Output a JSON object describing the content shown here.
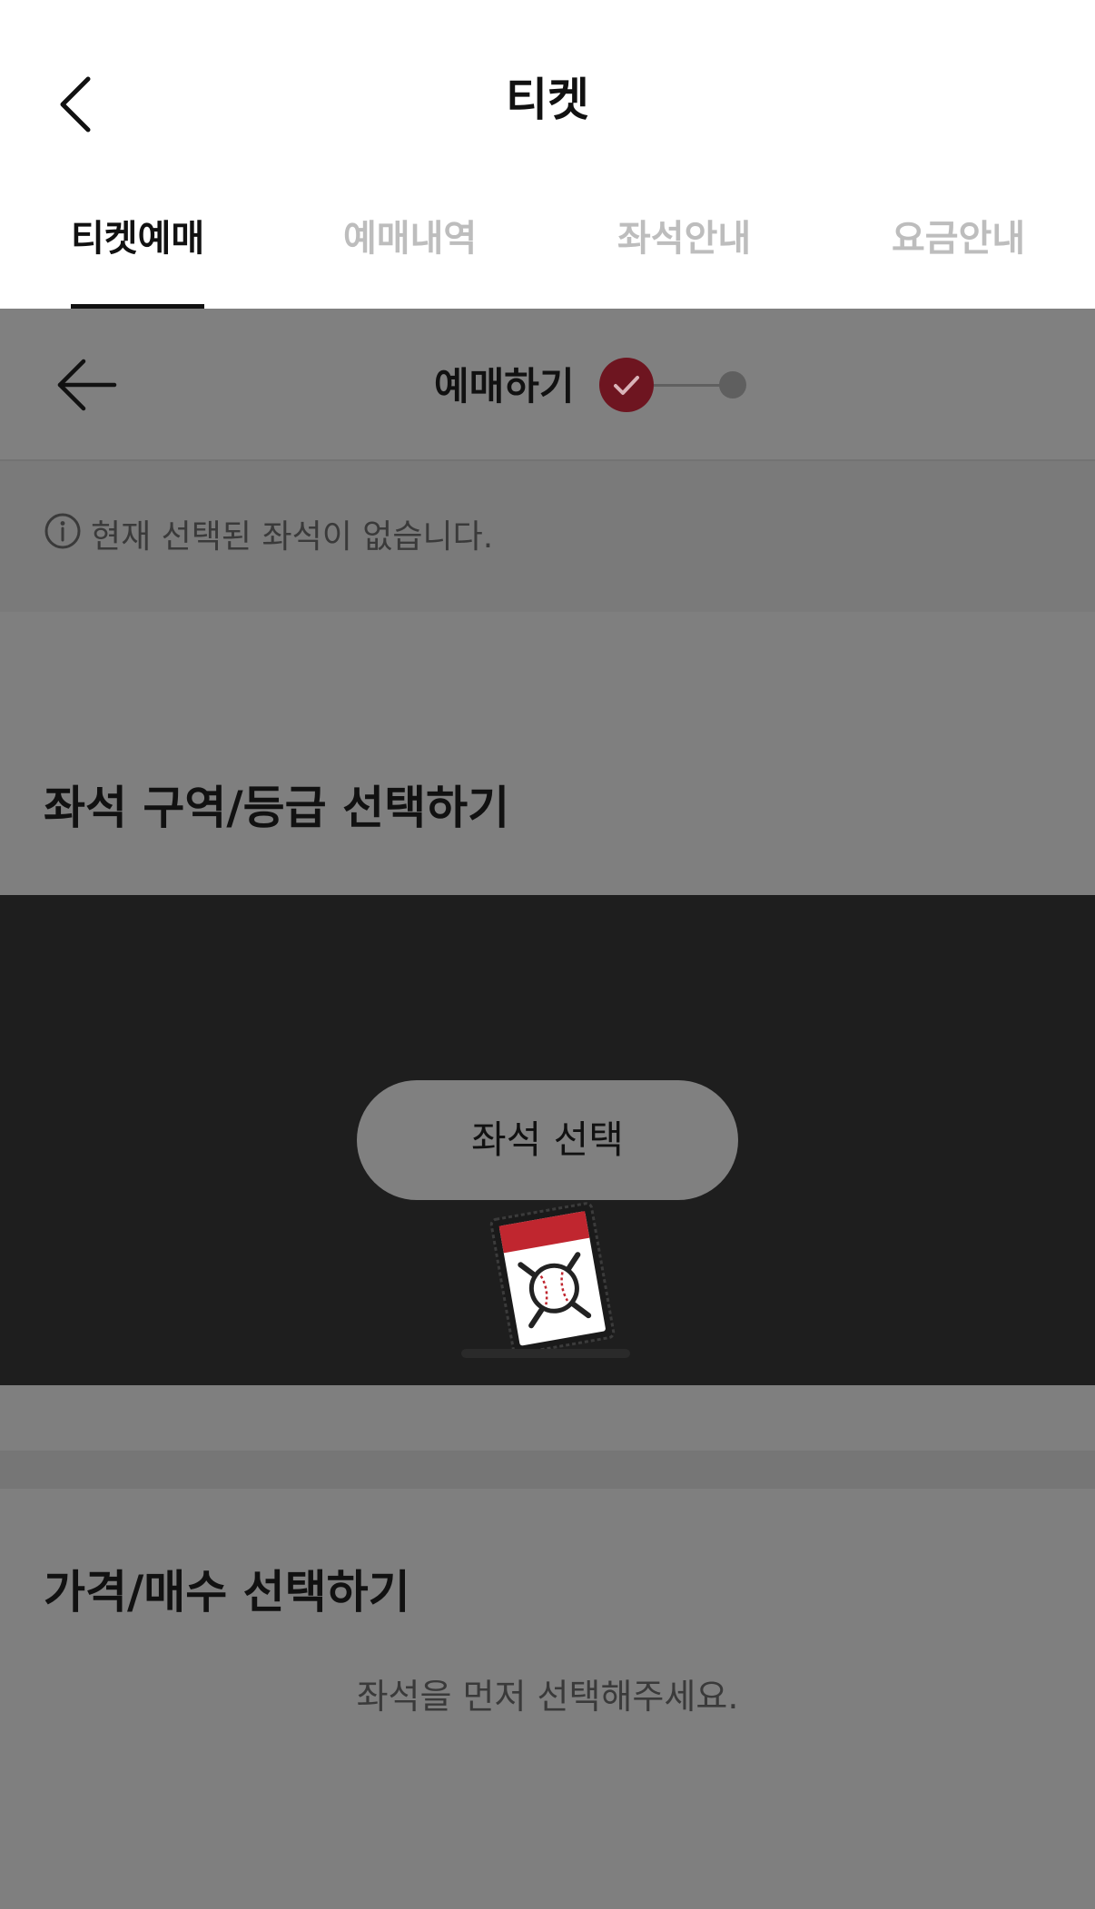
{
  "header": {
    "title": "티켓"
  },
  "tabs": [
    {
      "label": "티켓예매",
      "active": true
    },
    {
      "label": "예매내역",
      "active": false
    },
    {
      "label": "좌석안내",
      "active": false
    },
    {
      "label": "요금안내",
      "active": false
    }
  ],
  "step": {
    "title": "예매하기",
    "current_step": 1,
    "total_steps": 2
  },
  "notice": {
    "text": "현재 선택된 좌석이 없습니다."
  },
  "seat_section": {
    "title": "좌석 구역/등급 선택하기",
    "button_label": "좌석 선택"
  },
  "price_section": {
    "title": "가격/매수 선택하기",
    "empty_text": "좌석을 먼저 선택해주세요."
  },
  "colors": {
    "accent": "#6e1520",
    "overlay": "#808080",
    "seat_area": "#1e1e1e"
  },
  "icons": {
    "back": "chevron-left-icon",
    "step_back": "arrow-left-icon",
    "step_done": "check-icon",
    "info": "info-circle-icon",
    "loading": "baseball-ticket-icon"
  }
}
